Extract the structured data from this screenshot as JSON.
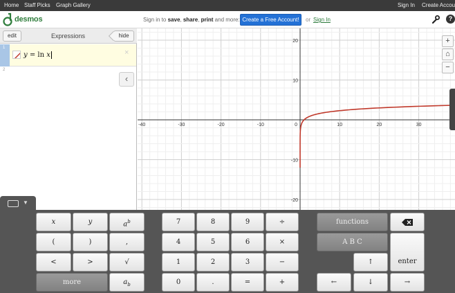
{
  "topnav": {
    "home": "Home",
    "staff_picks": "Staff Picks",
    "graph_gallery": "Graph Gallery",
    "sign_in": "Sign In",
    "create_account": "Create Account"
  },
  "header": {
    "logo": "desmos",
    "msg_prefix": "Sign in to",
    "save": "save",
    "share": "share",
    "print": "print",
    "msg_suffix": "and more:",
    "create_button": "Create a Free Account!",
    "or": "or",
    "sign_in_link": "Sign In",
    "help": "?"
  },
  "expressions": {
    "edit": "edit",
    "title": "Expressions",
    "hide": "hide",
    "rows": [
      {
        "number": "1",
        "latex": "y = ln x",
        "color": "#c0392b"
      },
      {
        "number": "2"
      }
    ],
    "delete": "×",
    "collapse": "‹"
  },
  "graph": {
    "x_ticks": [
      "-40",
      "-30",
      "-20",
      "-10",
      "0",
      "10",
      "20",
      "30"
    ],
    "y_ticks": [
      "20",
      "10",
      "-10",
      "-20"
    ],
    "zoom_in": "+",
    "zoom_out": "−",
    "home": "⌂"
  },
  "keypad": {
    "keys": {
      "x": "x",
      "y": "y",
      "a_pow": "a",
      "pow_b": "b",
      "paren_l": "(",
      "paren_r": ")",
      "comma": ",",
      "lt": "<",
      "gt": ">",
      "sqrt": "√",
      "more": "more",
      "a_sub": "a",
      "sub_b": "b",
      "n7": "7",
      "n8": "8",
      "n9": "9",
      "div": "÷",
      "n4": "4",
      "n5": "5",
      "n6": "6",
      "times": "×",
      "n1": "1",
      "n2": "2",
      "n3": "3",
      "minus": "−",
      "n0": "0",
      "dot": ".",
      "eq": "=",
      "plus": "+",
      "functions": "functions",
      "abc": "A B C",
      "enter": "enter",
      "up": "↑",
      "left": "←",
      "down": "↓",
      "right": "→"
    }
  }
}
